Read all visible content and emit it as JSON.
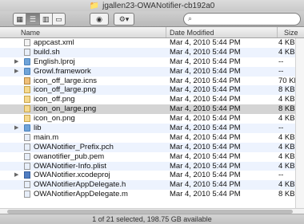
{
  "window": {
    "title": "jgallen23-OWANotifier-cb192a0"
  },
  "toolbar": {
    "view_modes": [
      "icon-view",
      "list-view",
      "column-view",
      "coverflow-view"
    ],
    "active_view": "list-view",
    "quick_look_icon": "eye-icon",
    "action_icon": "gear-icon",
    "search_placeholder": "",
    "search_value": ""
  },
  "columns": {
    "name": "Name",
    "date": "Date Modified",
    "size": "Size"
  },
  "files": [
    {
      "name": "appcast.xml",
      "date": "Mar 4, 2010 5:44 PM",
      "size": "4 KB",
      "type": "xml",
      "disclosure": false
    },
    {
      "name": "build.sh",
      "date": "Mar 4, 2010 5:44 PM",
      "size": "4 KB",
      "type": "code",
      "disclosure": false
    },
    {
      "name": "English.lproj",
      "date": "Mar 4, 2010 5:44 PM",
      "size": "--",
      "type": "folder",
      "disclosure": true
    },
    {
      "name": "Growl.framework",
      "date": "Mar 4, 2010 5:44 PM",
      "size": "--",
      "type": "folder",
      "disclosure": true
    },
    {
      "name": "icon_off_large.icns",
      "date": "Mar 4, 2010 5:44 PM",
      "size": "70 KB",
      "type": "icns",
      "disclosure": false
    },
    {
      "name": "icon_off_large.png",
      "date": "Mar 4, 2010 5:44 PM",
      "size": "8 KB",
      "type": "png",
      "disclosure": false
    },
    {
      "name": "icon_off.png",
      "date": "Mar 4, 2010 5:44 PM",
      "size": "4 KB",
      "type": "png",
      "disclosure": false
    },
    {
      "name": "icon_on_large.png",
      "date": "Mar 4, 2010 5:44 PM",
      "size": "8 KB",
      "type": "png",
      "disclosure": false
    },
    {
      "name": "icon_on.png",
      "date": "Mar 4, 2010 5:44 PM",
      "size": "4 KB",
      "type": "png",
      "disclosure": false
    },
    {
      "name": "lib",
      "date": "Mar 4, 2010 5:44 PM",
      "size": "--",
      "type": "folder",
      "disclosure": true
    },
    {
      "name": "main.m",
      "date": "Mar 4, 2010 5:44 PM",
      "size": "4 KB",
      "type": "code",
      "disclosure": false
    },
    {
      "name": "OWANotifier_Prefix.pch",
      "date": "Mar 4, 2010 5:44 PM",
      "size": "4 KB",
      "type": "code",
      "disclosure": false
    },
    {
      "name": "owanotifier_pub.pem",
      "date": "Mar 4, 2010 5:44 PM",
      "size": "4 KB",
      "type": "code",
      "disclosure": false
    },
    {
      "name": "OWANotifier-Info.plist",
      "date": "Mar 4, 2010 5:44 PM",
      "size": "4 KB",
      "type": "code",
      "disclosure": false
    },
    {
      "name": "OWANotifier.xcodeproj",
      "date": "Mar 4, 2010 5:44 PM",
      "size": "--",
      "type": "proj",
      "disclosure": true
    },
    {
      "name": "OWANotifierAppDelegate.h",
      "date": "Mar 4, 2010 5:44 PM",
      "size": "4 KB",
      "type": "code",
      "disclosure": false
    },
    {
      "name": "OWANotifierAppDelegate.m",
      "date": "Mar 4, 2010 5:44 PM",
      "size": "8 KB",
      "type": "code",
      "disclosure": false
    }
  ],
  "selected_index": 7,
  "status": {
    "text": "1 of 21 selected, 198.75 GB available"
  }
}
